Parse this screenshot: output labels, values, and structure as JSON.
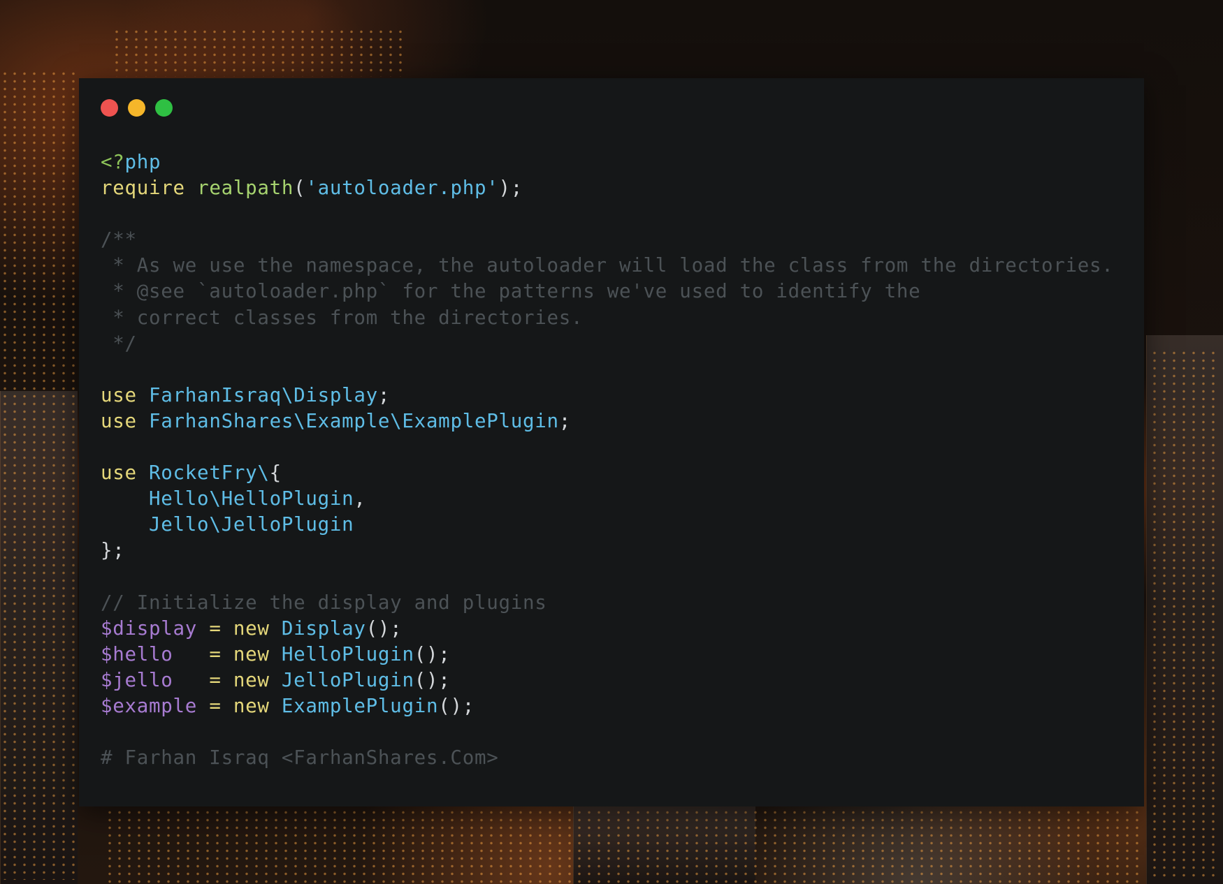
{
  "window": {
    "controls": [
      {
        "name": "close",
        "color": "#ef5350"
      },
      {
        "name": "minimize",
        "color": "#f5b62a"
      },
      {
        "name": "maximize",
        "color": "#2fc043"
      }
    ],
    "background": "#151718"
  },
  "code_lines": [
    [
      {
        "t": "<?",
        "c": "tag"
      },
      {
        "t": "php",
        "c": "str"
      }
    ],
    [
      {
        "t": "require ",
        "c": "kw"
      },
      {
        "t": "realpath",
        "c": "fn"
      },
      {
        "t": "(",
        "c": "pun"
      },
      {
        "t": "'autoloader.php'",
        "c": "str"
      },
      {
        "t": ");",
        "c": "pun"
      }
    ],
    [],
    [
      {
        "t": "/**",
        "c": "cmt"
      }
    ],
    [
      {
        "t": " * As we use the namespace, the autoloader will load the class from the directories.",
        "c": "cmt"
      }
    ],
    [
      {
        "t": " * @see `autoloader.php` for the patterns we've used to identify the",
        "c": "cmt"
      }
    ],
    [
      {
        "t": " * correct classes from the directories.",
        "c": "cmt"
      }
    ],
    [
      {
        "t": " */",
        "c": "cmt"
      }
    ],
    [],
    [
      {
        "t": "use ",
        "c": "kw"
      },
      {
        "t": "FarhanIsraq\\Display",
        "c": "cls"
      },
      {
        "t": ";",
        "c": "pun"
      }
    ],
    [
      {
        "t": "use ",
        "c": "kw"
      },
      {
        "t": "FarhanShares\\Example\\ExamplePlugin",
        "c": "cls"
      },
      {
        "t": ";",
        "c": "pun"
      }
    ],
    [],
    [
      {
        "t": "use ",
        "c": "kw"
      },
      {
        "t": "RocketFry\\",
        "c": "cls"
      },
      {
        "t": "{",
        "c": "pun"
      }
    ],
    [
      {
        "t": "    ",
        "c": "pun"
      },
      {
        "t": "Hello\\HelloPlugin",
        "c": "cls"
      },
      {
        "t": ",",
        "c": "pun"
      }
    ],
    [
      {
        "t": "    ",
        "c": "pun"
      },
      {
        "t": "Jello\\JelloPlugin",
        "c": "cls"
      }
    ],
    [
      {
        "t": "};",
        "c": "pun"
      }
    ],
    [],
    [
      {
        "t": "// Initialize the display and plugins",
        "c": "cmt"
      }
    ],
    [
      {
        "t": "$display",
        "c": "var"
      },
      {
        "t": " = ",
        "c": "kw"
      },
      {
        "t": "new ",
        "c": "kw"
      },
      {
        "t": "Display",
        "c": "cls"
      },
      {
        "t": "();",
        "c": "pun"
      }
    ],
    [
      {
        "t": "$hello",
        "c": "var"
      },
      {
        "t": "   = ",
        "c": "kw"
      },
      {
        "t": "new ",
        "c": "kw"
      },
      {
        "t": "HelloPlugin",
        "c": "cls"
      },
      {
        "t": "();",
        "c": "pun"
      }
    ],
    [
      {
        "t": "$jello",
        "c": "var"
      },
      {
        "t": "   = ",
        "c": "kw"
      },
      {
        "t": "new ",
        "c": "kw"
      },
      {
        "t": "JelloPlugin",
        "c": "cls"
      },
      {
        "t": "();",
        "c": "pun"
      }
    ],
    [
      {
        "t": "$example",
        "c": "var"
      },
      {
        "t": " = ",
        "c": "kw"
      },
      {
        "t": "new ",
        "c": "kw"
      },
      {
        "t": "ExamplePlugin",
        "c": "cls"
      },
      {
        "t": "();",
        "c": "pun"
      }
    ],
    [],
    [
      {
        "t": "# Farhan Israq <FarhanShares.Com>",
        "c": "cmt"
      }
    ]
  ]
}
